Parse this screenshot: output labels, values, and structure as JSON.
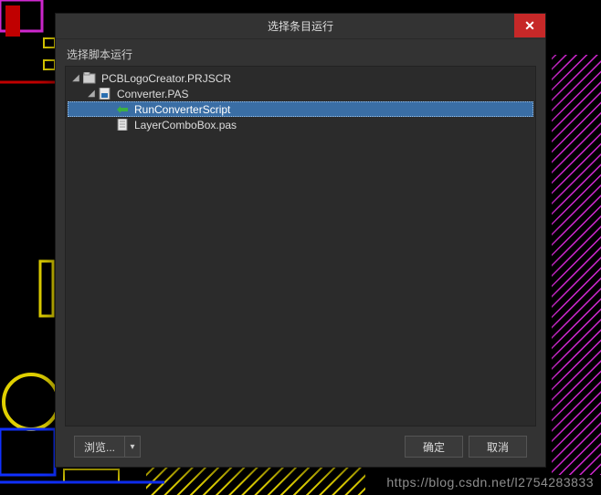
{
  "dialog": {
    "title": "选择条目运行",
    "section_label": "选择脚本运行",
    "close_glyph": "✕"
  },
  "tree": {
    "root": {
      "label": "PCBLogoCreator.PRJSCR",
      "icon": "project-icon",
      "expanded": true,
      "children": [
        {
          "label": "Converter.PAS",
          "icon": "pas-icon",
          "expanded": true,
          "children": [
            {
              "label": "RunConverterScript",
              "icon": "proc-icon",
              "selected": true
            },
            {
              "label": "LayerComboBox.pas",
              "icon": "file-icon",
              "selected": false
            }
          ]
        }
      ]
    }
  },
  "footer": {
    "browse_label": "浏览...",
    "ok_label": "确定",
    "cancel_label": "取消",
    "drop_glyph": "▾"
  },
  "watermark": "https://blog.csdn.net/l2754283833"
}
